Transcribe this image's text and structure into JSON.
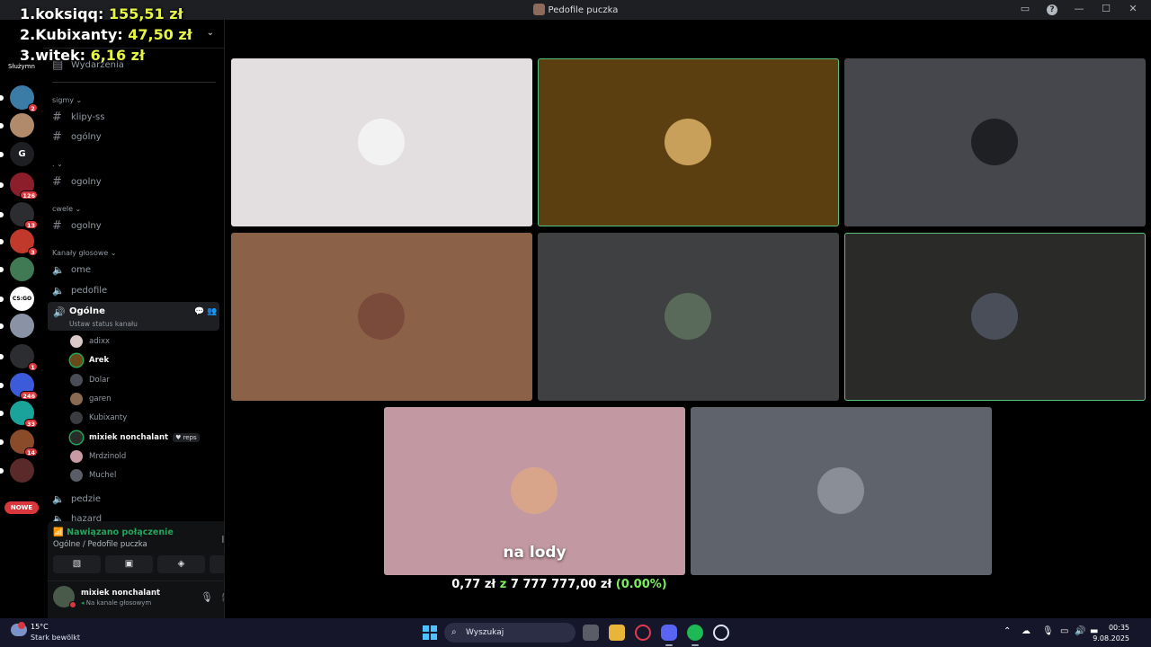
{
  "window": {
    "title": "Pedofile puczka"
  },
  "overlay": {
    "rank1": {
      "label": "1.koksiqq:",
      "amount": "155,51 zł"
    },
    "rank2": {
      "label": "2.Kubixanty:",
      "amount": "47,50 zł"
    },
    "rank3": {
      "label": "3.witek:",
      "amount": "6,16 zł"
    },
    "goal": {
      "current": "0,77 zł",
      "sep": "z",
      "target": "7 777 777,00 zł",
      "percent": "(0.00%)",
      "progress_fraction": 0.0
    }
  },
  "guilds": {
    "top_label": "Służymn",
    "items": [
      {
        "name": "server-1",
        "badge": "2",
        "color": "#3a7ca5"
      },
      {
        "name": "server-2",
        "badge": "",
        "color": "#b08a6a"
      },
      {
        "name": "server-g",
        "letter": "G",
        "badge": "",
        "color": "#1e1f22"
      },
      {
        "name": "server-3",
        "badge": "126",
        "color": "#8b1e2a"
      },
      {
        "name": "server-4",
        "badge": "13",
        "color": "#2b2d31"
      },
      {
        "name": "server-5",
        "badge": "3",
        "color": "#c0392b"
      },
      {
        "name": "server-6",
        "badge": "",
        "color": "#3f7a55"
      },
      {
        "name": "server-csgo",
        "badge": "",
        "color": "#ffffff",
        "letter": "CS:GO"
      },
      {
        "name": "server-7",
        "badge": "",
        "color": "#8a93a5"
      },
      {
        "name": "server-8",
        "badge": "1",
        "color": "#2b2d31"
      },
      {
        "name": "server-9",
        "badge": "246",
        "color": "#3b5bdb"
      },
      {
        "name": "server-10",
        "badge": "33",
        "color": "#1aa39a"
      },
      {
        "name": "server-11",
        "badge": "14",
        "color": "#8a4b2a"
      },
      {
        "name": "server-12",
        "badge": "",
        "color": "#5a2a2a"
      }
    ],
    "new_label": "NOWE"
  },
  "sidebar": {
    "events": "Wydarzenia",
    "cat_sigmy": "sigmy",
    "ch_klipy": "klipy-ss",
    "ch_ogolny": "ogólny",
    "cat_dot": ".",
    "ch_ogolny2": "ogolny",
    "cat_cwele": "cwele",
    "ch_ogolny3": "ogolny",
    "cat_voice": "Kanały głosowe",
    "vc_ome": "ome",
    "vc_pedofile": "pedofile",
    "vc_active": {
      "name": "Ogólne",
      "status": "Ustaw status kanału"
    },
    "voice_users": [
      {
        "name": "adixx",
        "on": false,
        "speaking": false,
        "color": "#d9c9c9"
      },
      {
        "name": "Arek",
        "on": true,
        "speaking": true,
        "color": "#6b4a1a"
      },
      {
        "name": "Dolar",
        "on": false,
        "speaking": false,
        "color": "#4a4d55"
      },
      {
        "name": "garen",
        "on": false,
        "speaking": false,
        "color": "#8a6a50"
      },
      {
        "name": "Kubixanty",
        "on": false,
        "speaking": false,
        "color": "#3a3c40"
      },
      {
        "name": "mixiek nonchalant",
        "on": true,
        "speaking": true,
        "color": "#2a2c2a",
        "tag": "reps"
      },
      {
        "name": "Mrdzinold",
        "on": false,
        "speaking": false,
        "color": "#c89aa4"
      },
      {
        "name": "Muchel",
        "on": false,
        "speaking": false,
        "color": "#5a5d66"
      }
    ],
    "vc_pedzie": "pedzie",
    "vc_hazard": "hazard"
  },
  "voice_panel": {
    "connected": "Nawiązano połączenie",
    "channel": "Ogólne / Pedofile puczka",
    "user_name": "mixiek nonchalant",
    "user_status": "Na kanale głosowym"
  },
  "tiles": [
    {
      "name": "tile-adixx",
      "bg": "#e3dfe0",
      "av": "#f2f2f2",
      "speak": false
    },
    {
      "name": "tile-arek",
      "bg": "#5b3f10",
      "av": "#c9a05a",
      "speak": true
    },
    {
      "name": "tile-dolar",
      "bg": "#45474c",
      "av": "#1e2024",
      "speak": false
    },
    {
      "name": "tile-garen",
      "bg": "#8b6248",
      "av": "#7a4a3a",
      "speak": false
    },
    {
      "name": "tile-kubixanty",
      "bg": "#3f4042",
      "av": "#5a6a5a",
      "speak": false
    },
    {
      "name": "tile-mixiek",
      "bg": "#2a2b29",
      "av": "#4a4e58",
      "speak": true
    },
    {
      "name": "tile-mrdzinold",
      "bg": "#c298a2",
      "av": "#d9a58a",
      "speak": false,
      "caption": "na lody"
    },
    {
      "name": "tile-muchel",
      "bg": "#5f636b",
      "av": "#8a8e96",
      "speak": false
    }
  ],
  "taskbar": {
    "temp": "15°C",
    "weather": "Stark bewölkt",
    "search": "Wyszukaj",
    "time": "00:35",
    "date": "9.08.2025"
  }
}
